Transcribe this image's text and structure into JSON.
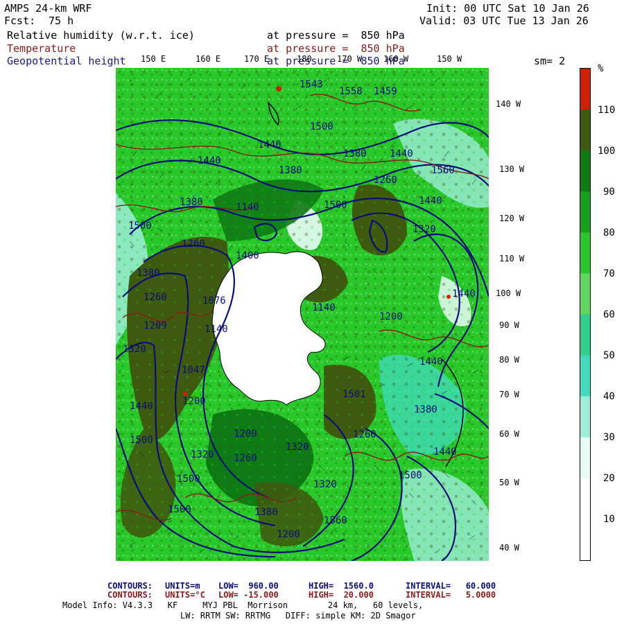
{
  "header": {
    "model": "AMPS 24-km WRF",
    "fcst_label": "Fcst:",
    "fcst_value": "75 h",
    "init": "Init: 00 UTC Sat 10 Jan 26",
    "valid": "Valid: 03 UTC Tue 13 Jan 26"
  },
  "fields": [
    {
      "name": "Relative humidity (w.r.t. ice)",
      "level": "at pressure =  850 hPa",
      "color": "#000000"
    },
    {
      "name": "Temperature",
      "level": "at pressure =  850 hPa",
      "color": "#8b1a1a"
    },
    {
      "name": "Geopotential height",
      "level": "at pressure =  850 hPa",
      "color": "#1a1a8b"
    }
  ],
  "smoothing": "sm= 2",
  "top_lon_labels": [
    "150 E",
    "160 E",
    "170 E",
    "180",
    "170 W",
    "160 W",
    "150 W"
  ],
  "right_lon_labels": [
    "140 W",
    "130 W",
    "120 W",
    "110 W",
    "100 W",
    "90 W",
    "80 W",
    "70 W",
    "60 W",
    "50 W",
    "40 W"
  ],
  "height_contour_labels": [
    "1543",
    "1558",
    "1459",
    "1500",
    "1440",
    "1380",
    "1440",
    "1560",
    "1440",
    "1380",
    "1260",
    "1380",
    "1440",
    "1500",
    "1500",
    "1320",
    "1260",
    "1140",
    "1400",
    "1380",
    "1260",
    "1076",
    "1140",
    "1140",
    "1209",
    "1200",
    "1320",
    "1047",
    "1200",
    "1440",
    "1320",
    "1200",
    "1260",
    "1320",
    "1260",
    "1380",
    "1440",
    "1500",
    "1500",
    "1500",
    "1560",
    "1500",
    "1380",
    "1200",
    "1440",
    "1320",
    "1501",
    "1440"
  ],
  "colorbar": {
    "unit": "%",
    "ticks": [
      "110",
      "100",
      "90",
      "80",
      "70",
      "60",
      "50",
      "40",
      "30",
      "20",
      "10"
    ],
    "bins": [
      {
        "range": "110+",
        "color": "#cc2200"
      },
      {
        "range": "100-110",
        "color": "#3d5a0e"
      },
      {
        "range": "90-100",
        "color": "#0e7a14"
      },
      {
        "range": "80-90",
        "color": "#18a018"
      },
      {
        "range": "70-80",
        "color": "#28c828"
      },
      {
        "range": "60-70",
        "color": "#5ed85e"
      },
      {
        "range": "50-60",
        "color": "#2ed08c"
      },
      {
        "range": "40-50",
        "color": "#40dcc0"
      },
      {
        "range": "30-40",
        "color": "#9ceed8"
      },
      {
        "range": "20-30",
        "color": "#e8fbf6"
      },
      {
        "range": "10-20",
        "color": "#ffffff"
      },
      {
        "range": "0-10",
        "color": "#ffffff"
      }
    ]
  },
  "footer": {
    "contours1": {
      "label": "CONTOURS:",
      "units": "UNITS=m",
      "low": "LOW=  960.00",
      "high": "HIGH=  1560.0",
      "interval": "INTERVAL=   60.000"
    },
    "contours2": {
      "label": "CONTOURS:",
      "units": "UNITS=°C",
      "low": "LOW= -15.000",
      "high": "HIGH=  20.000",
      "interval": "INTERVAL=   5.0000"
    },
    "model_info_1": "Model Info: V4.3.3   KF     MYJ PBL  Morrison        24 km,   60 levels,",
    "model_info_2": "LW: RRTM SW: RRTMG   DIFF: simple KM: 2D Smagor"
  }
}
